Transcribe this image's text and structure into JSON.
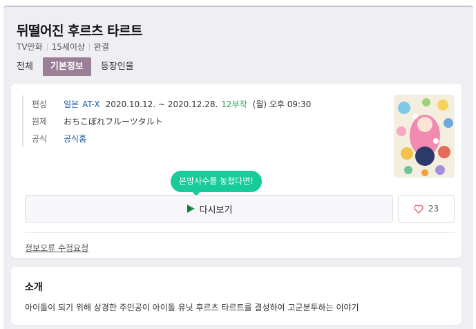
{
  "header": {
    "title": "뒤떨어진 후르츠 타르트",
    "meta": [
      "TV만화",
      "15세이상",
      "완결"
    ]
  },
  "tabs": [
    {
      "label": "전체",
      "active": false
    },
    {
      "label": "기본정보",
      "active": true
    },
    {
      "label": "등장인물",
      "active": false
    }
  ],
  "info": {
    "schedule_label": "편성",
    "country": "일본",
    "channel": "AT-X",
    "period": "2020.10.12. ~ 2020.12.28.",
    "episodes": "12부작",
    "airtime": "(월) 오후 09:30",
    "original_label": "원제",
    "original_title": "おちこぼれフルーツタルト",
    "official_label": "공식",
    "official_link": "공식홈"
  },
  "tooltip": "본방사수를 놓쳤다면!",
  "rewatch_label": "다시보기",
  "like_count": "23",
  "report_label": "정보오류 수정요청",
  "intro": {
    "title": "소개",
    "text": "아이돌이 되기 위해 상경한 주인공이 아이돌 유닛 후르츠 타르트를 결성하여 고군분투하는 이야기"
  },
  "colors": {
    "active_tab": "#9a7f96",
    "link": "#1e5ba8",
    "episodes": "#23a34b",
    "tooltip": "#18cb9a",
    "play_icon": "#1aa34a"
  },
  "icons": [
    "play-icon",
    "heart-icon"
  ]
}
